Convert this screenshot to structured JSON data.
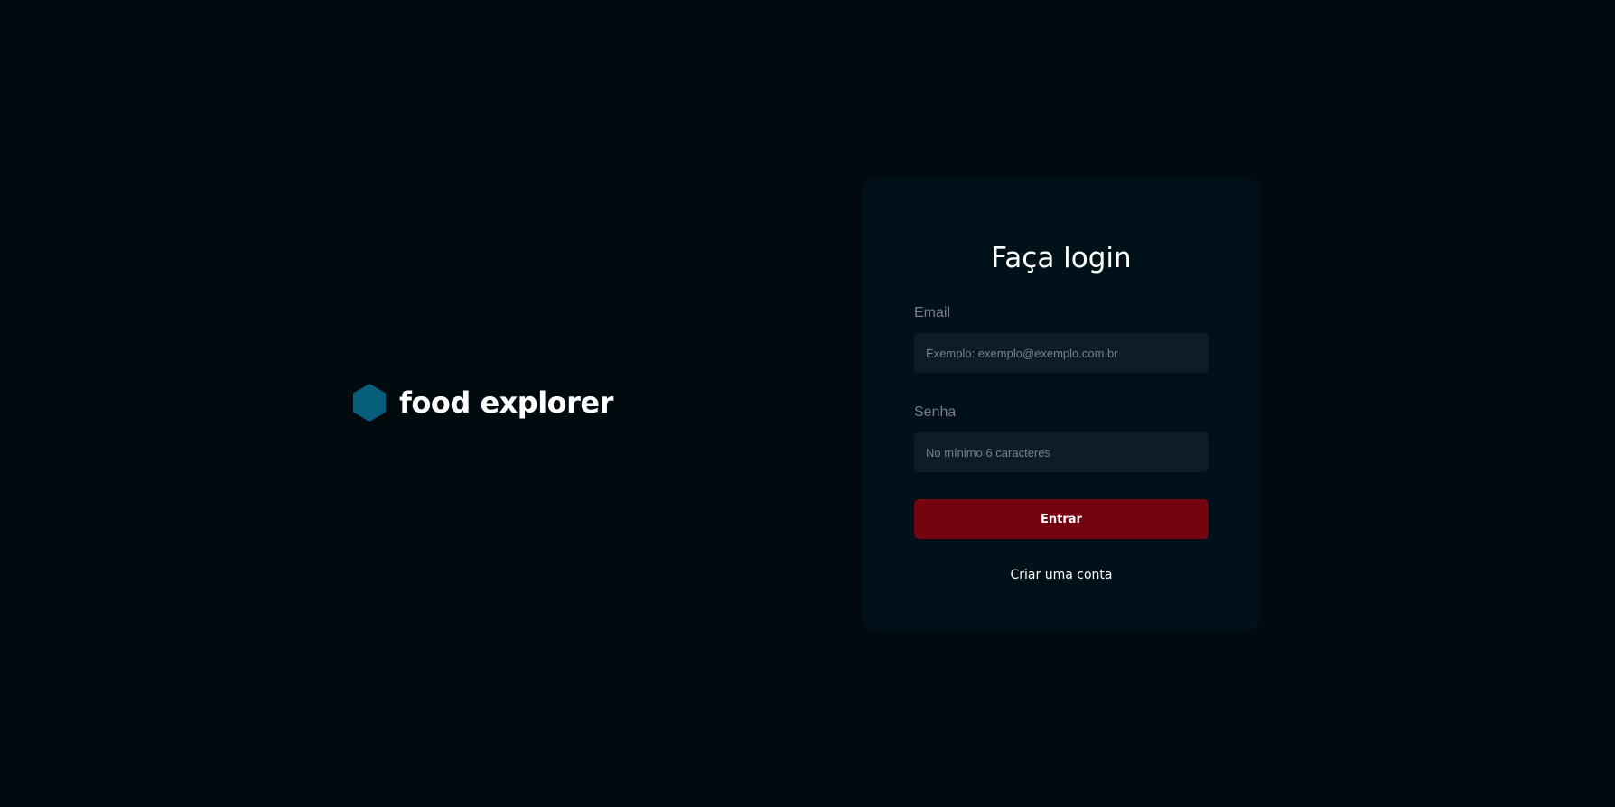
{
  "brand": {
    "name": "food explorer",
    "icon": "hexagon-icon",
    "icon_color": "#065e7c"
  },
  "login": {
    "title": "Faça login",
    "email": {
      "label": "Email",
      "placeholder": "Exemplo: exemplo@exemplo.com.br",
      "value": ""
    },
    "password": {
      "label": "Senha",
      "placeholder": "No mínimo 6 caracteres",
      "value": ""
    },
    "submit_label": "Entrar",
    "signup_label": "Criar uma conta"
  },
  "colors": {
    "background": "#000a0f",
    "card": "#001119",
    "input": "#0d1d25",
    "button": "#750310",
    "muted_text": "#7c7c8a"
  }
}
